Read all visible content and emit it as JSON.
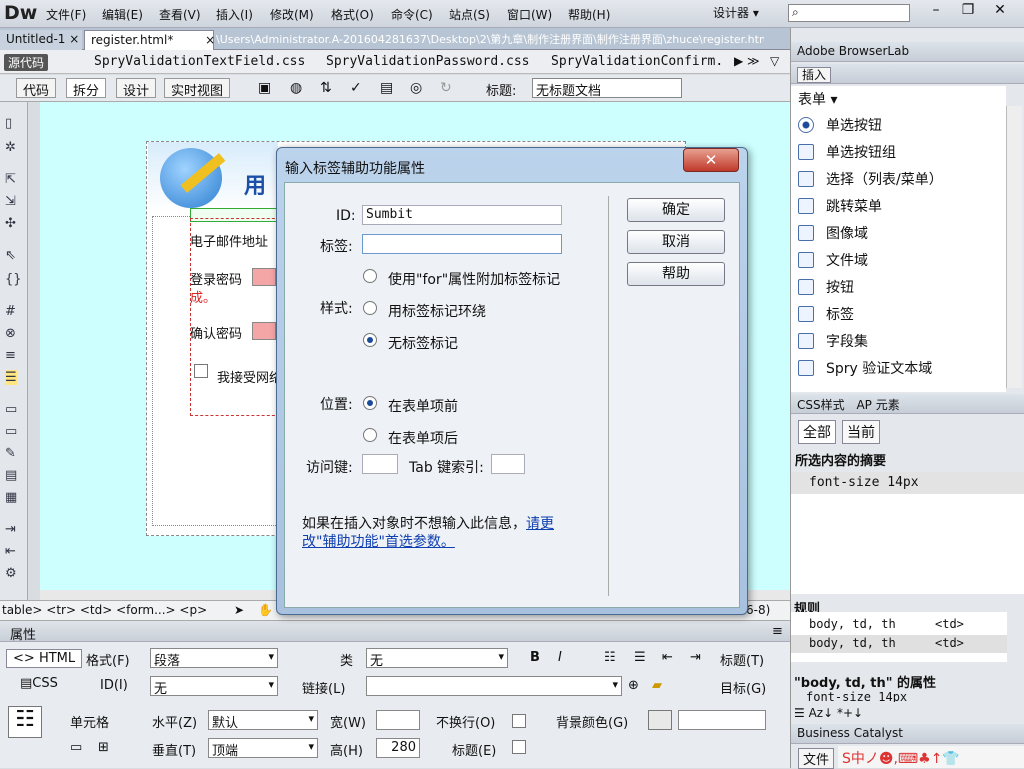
{
  "app": {
    "logo": "Dw",
    "designer": "设计器 ▾"
  },
  "menu": [
    "文件(F)",
    "编辑(E)",
    "查看(V)",
    "插入(I)",
    "修改(M)",
    "格式(O)",
    "命令(C)",
    "站点(S)",
    "窗口(W)",
    "帮助(H)"
  ],
  "window_controls": {
    "minimize": "–",
    "restore": "❐",
    "close": "✕"
  },
  "tabs": [
    {
      "label": "Untitled-1",
      "close": "×"
    },
    {
      "label": "register.html*",
      "close": "×"
    }
  ],
  "file_path": "\\Users\\Administrator.A-201604281637\\Desktop\\2\\第九章\\制作注册界面\\制作注册界面\\zhuce\\register.html",
  "related_files": {
    "source": "源代码",
    "files": [
      "SpryValidationTextField.css",
      "SpryValidationPassword.css",
      "SpryValidationConfirm."
    ]
  },
  "doc_toolbar": {
    "views": [
      "代码",
      "拆分",
      "设计",
      "实时视图"
    ],
    "title_label": "标题:",
    "title_value": "无标题文档"
  },
  "canvas": {
    "brand": "用",
    "fields": [
      "电子邮件地址",
      "登录密码",
      "确认密码"
    ],
    "error_fragment": "成。",
    "agree_fragment": "我接受网络"
  },
  "tag_selector": {
    "path": "table> <tr> <td> <form...> <p>",
    "zoom_fragment": "6-8)"
  },
  "properties": {
    "header": "属性",
    "html_btn": "HTML",
    "css_btn": "CSS",
    "format_label": "格式(F)",
    "format_value": "段落",
    "class_label": "类",
    "class_value": "无",
    "bold": "B",
    "italic": "I",
    "title_label": "标题(T)",
    "id_label": "ID(I)",
    "id_value": "无",
    "link_label": "链接(L)",
    "target_label": "目标(G)",
    "cell_label": "单元格",
    "horz_label": "水平(Z)",
    "horz_value": "默认",
    "width_label": "宽(W)",
    "nowrap_label": "不换行(O)",
    "bgcolor_label": "背景颜色(G)",
    "vert_label": "垂直(T)",
    "vert_value": "顶端",
    "height_label": "高(H)",
    "height_value": "280",
    "header_label": "标题(E)"
  },
  "right_panel": {
    "browserlab": "Adobe BrowserLab",
    "insert_tab": "插入",
    "category": "表单 ▾",
    "insert_items": [
      {
        "label": "单选按钮",
        "icon": "radio-icon"
      },
      {
        "label": "单选按钮组",
        "icon": "radio-group-icon"
      },
      {
        "label": "选择（列表/菜单）",
        "icon": "list-menu-icon"
      },
      {
        "label": "跳转菜单",
        "icon": "jump-menu-icon"
      },
      {
        "label": "图像域",
        "icon": "image-field-icon"
      },
      {
        "label": "文件域",
        "icon": "file-field-icon"
      },
      {
        "label": "按钮",
        "icon": "button-icon"
      },
      {
        "label": "标签",
        "icon": "label-icon"
      },
      {
        "label": "字段集",
        "icon": "fieldset-icon"
      },
      {
        "label": "Spry 验证文本域",
        "icon": "spry-textfield-icon"
      }
    ],
    "css_tab": "CSS样式",
    "ap_tab": "AP 元素",
    "all_btn": "全部",
    "current_btn": "当前",
    "summary_title": "所选内容的摘要",
    "summary_prop": "font-size  14px",
    "rules_title": "规则",
    "rules": [
      {
        "selector": "body, td, th",
        "tag": "<td>"
      },
      {
        "selector": "body, td, th",
        "tag": "<td>"
      }
    ],
    "props_title": "\"body, td, th\" 的属性",
    "props_fragment": "font-size  14px",
    "bc_header": "Business Catalyst",
    "files_tab": "文件",
    "ime": "S中ノ☻,⌨♣↑👕"
  },
  "dialog": {
    "title": "输入标签辅助功能属性",
    "close": "✕",
    "id_label": "ID:",
    "id_value": "Sumbit",
    "label_label": "标签:",
    "label_value": "",
    "style_label": "样式:",
    "style_options": [
      {
        "label": "使用\"for\"属性附加标签标记",
        "checked": false
      },
      {
        "label": "用标签标记环绕",
        "checked": false
      },
      {
        "label": "无标签标记",
        "checked": true
      }
    ],
    "position_label": "位置:",
    "position_options": [
      {
        "label": "在表单项前",
        "checked": true
      },
      {
        "label": "在表单项后",
        "checked": false
      }
    ],
    "accesskey_label": "访问键:",
    "tabindex_label": "Tab 键索引:",
    "note_text": "如果在插入对象时不想输入此信息，",
    "note_link": "请更改\"辅助功能\"首选参数。",
    "ok": "确定",
    "cancel": "取消",
    "help": "帮助"
  }
}
